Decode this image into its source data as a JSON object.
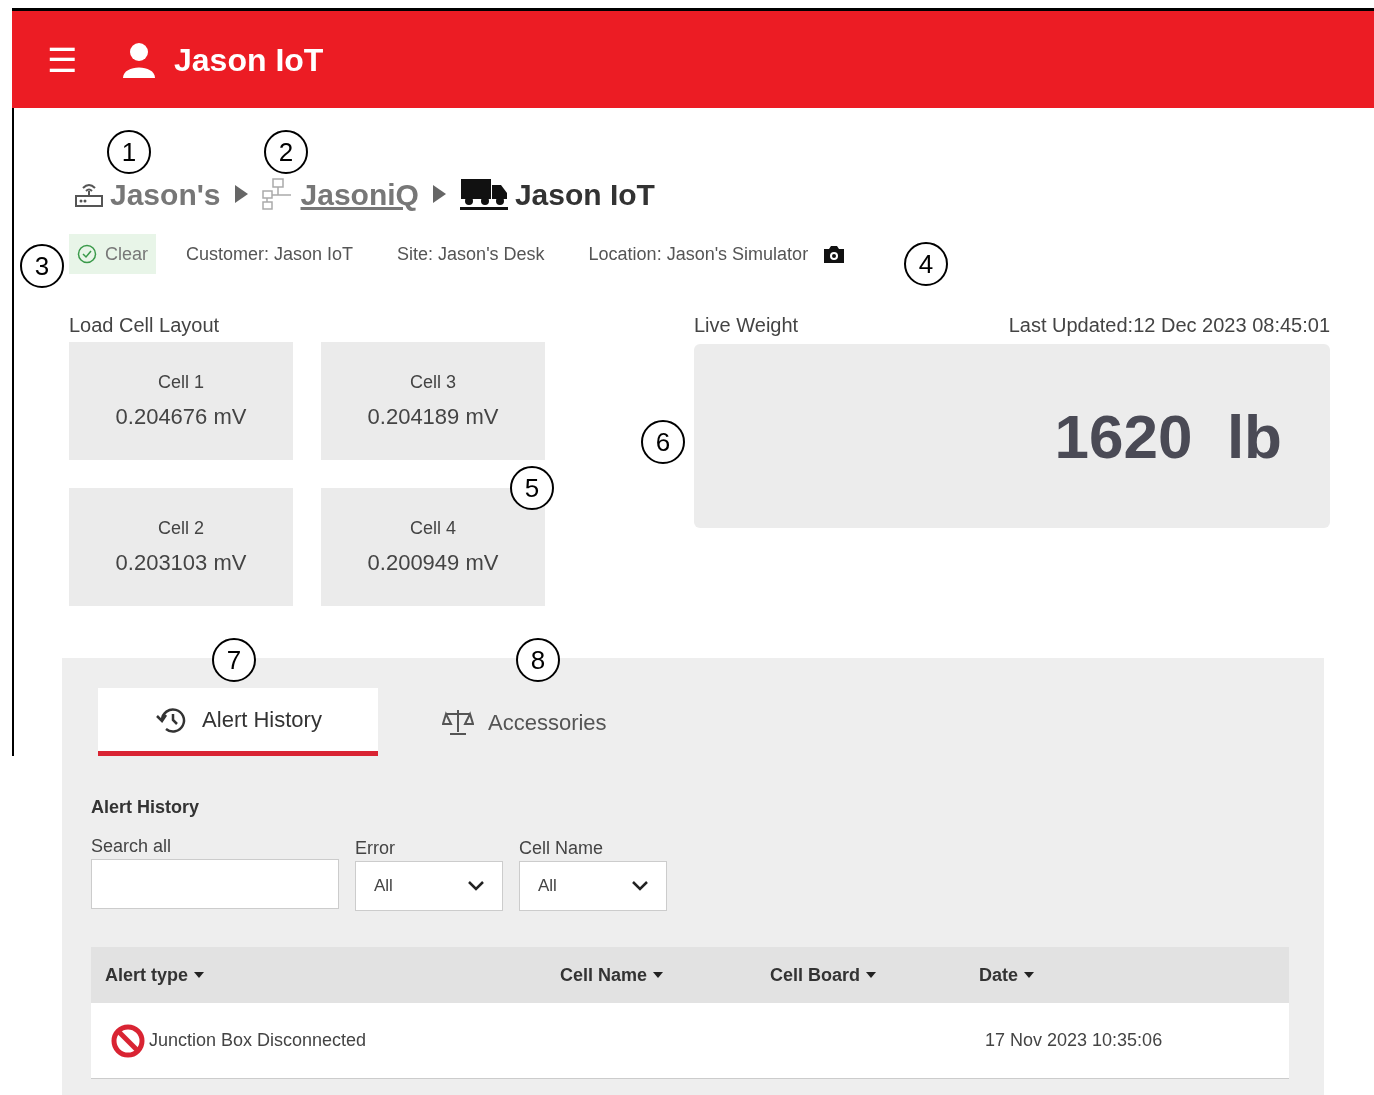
{
  "header": {
    "menu_icon": "☰",
    "title": "Jason IoT"
  },
  "breadcrumb": [
    {
      "label": "Jason's",
      "kind": "plain"
    },
    {
      "label": "JasoniQ",
      "kind": "link"
    },
    {
      "label": "Jason IoT",
      "kind": "current"
    }
  ],
  "status": {
    "label": "Clear",
    "customer": "Customer: Jason IoT",
    "site": "Site: Jason's Desk",
    "location": "Location: Jason's Simulator"
  },
  "load_cell_layout": {
    "title": "Load Cell Layout",
    "cells": [
      {
        "name": "Cell 1",
        "reading": "0.204676 mV"
      },
      {
        "name": "Cell 3",
        "reading": "0.204189 mV"
      },
      {
        "name": "Cell 2",
        "reading": "0.203103 mV"
      },
      {
        "name": "Cell 4",
        "reading": "0.200949 mV"
      }
    ]
  },
  "live_weight": {
    "title": "Live Weight",
    "last_updated": "Last Updated:12 Dec 2023 08:45:01",
    "value": "1620",
    "unit": "lb"
  },
  "tabs": [
    {
      "label": "Alert History",
      "selected": true
    },
    {
      "label": "Accessories",
      "selected": false
    }
  ],
  "alert_history": {
    "title": "Alert History",
    "search": {
      "label": "Search all"
    },
    "filters": [
      {
        "label": "Error",
        "value": "All"
      },
      {
        "label": "Cell Name",
        "value": "All"
      }
    ],
    "table": {
      "columns": [
        "Alert type",
        "Cell Name",
        "Cell Board",
        "Date"
      ],
      "rows": [
        {
          "alert_type": "Junction Box Disconnected",
          "date": "17 Nov 2023 10:35:06"
        }
      ]
    }
  },
  "callouts": [
    "1",
    "2",
    "3",
    "4",
    "5",
    "6",
    "7",
    "8"
  ]
}
